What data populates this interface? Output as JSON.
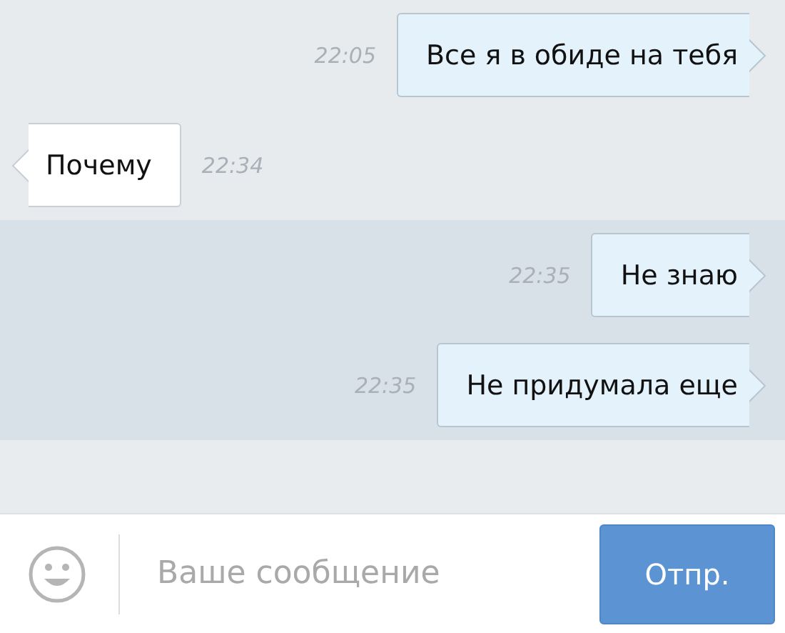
{
  "messages": [
    {
      "kind": "outgoing",
      "text": "Все я в обиде на тебя",
      "time": "22:05",
      "highlighted": false
    },
    {
      "kind": "incoming",
      "text": "Почему",
      "time": "22:34",
      "highlighted": false
    },
    {
      "kind": "outgoing",
      "text": "Не знаю",
      "time": "22:35",
      "highlighted": true
    },
    {
      "kind": "outgoing",
      "text": "Не придумала еще",
      "time": "22:35",
      "highlighted": true
    }
  ],
  "composer": {
    "placeholder": "Ваше сообщение",
    "send_button": "Отпр."
  }
}
